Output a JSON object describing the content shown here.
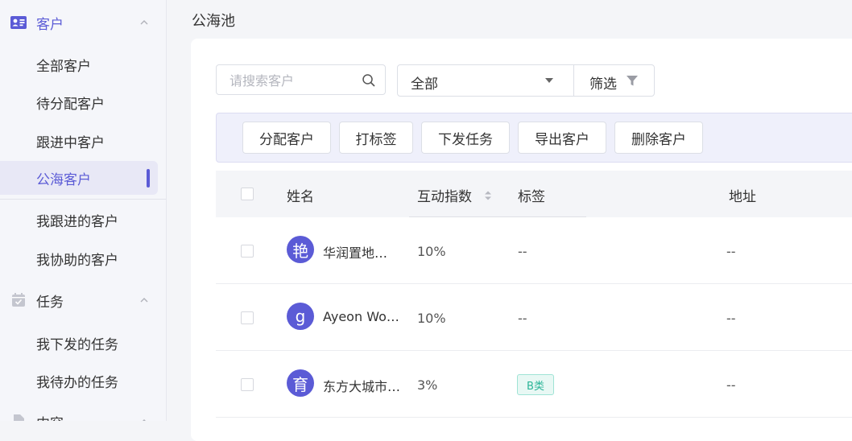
{
  "sidebar": {
    "customer_group": {
      "title": "客户",
      "icon": "contact-card-icon"
    },
    "customer_items": [
      "全部客户",
      "待分配客户",
      "跟进中客户",
      "公海客户",
      "我跟进的客户",
      "我协助的客户"
    ],
    "active_item": "公海客户",
    "task_group": {
      "title": "任务",
      "icon": "calendar-check-icon"
    },
    "task_items": [
      "我下发的任务",
      "我待办的任务"
    ],
    "third_group": {
      "title": "内容",
      "icon": "document-icon"
    }
  },
  "page": {
    "title": "公海池"
  },
  "toolbar": {
    "search_placeholder": "请搜索客户",
    "select_value": "全部",
    "filter_label": "筛选"
  },
  "actions": [
    "分配客户",
    "打标签",
    "下发任务",
    "导出客户",
    "删除客户"
  ],
  "table": {
    "headers": {
      "name": "姓名",
      "interaction": "互动指数",
      "tags": "标签",
      "address": "地址"
    },
    "rows": [
      {
        "avatar": "艳",
        "name": "华润置地（广州）…",
        "interaction": "10%",
        "tags": "--",
        "tag_chip": "",
        "address": "--"
      },
      {
        "avatar": "g",
        "name": "Ayeon Wong",
        "interaction": "10%",
        "tags": "--",
        "tag_chip": "",
        "address": "--"
      },
      {
        "avatar": "育",
        "name": "东方大城市…",
        "interaction": "3%",
        "tags": "",
        "tag_chip": "B类",
        "address": "--"
      }
    ]
  },
  "colors": {
    "accent": "#5b5bd6",
    "tag_text": "#2bb598",
    "tag_bg": "#e8f8f4"
  }
}
